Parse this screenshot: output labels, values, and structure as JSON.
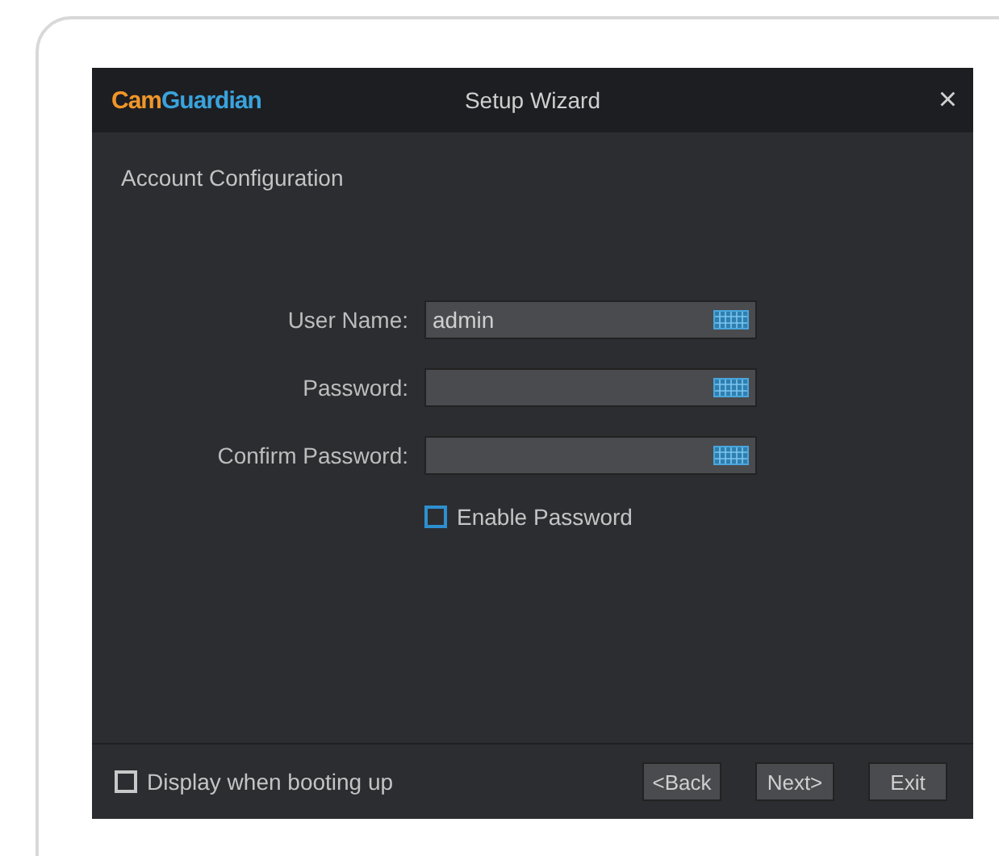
{
  "window": {
    "logo": [
      "Cam",
      "Guardian"
    ],
    "title": "Setup Wizard",
    "close": "×"
  },
  "section_title": "Account Configuration",
  "fields": [
    {
      "label": "User Name:",
      "value": "admin"
    },
    {
      "label": "Password:"
    },
    {
      "label": "Confirm Password:"
    }
  ],
  "enable_password": {
    "label": "Enable Password",
    "checked": false
  },
  "footer": {
    "display_on_boot": {
      "label": "Display when booting up",
      "checked": false
    },
    "buttons": [
      "<Back",
      "Next>",
      "Exit"
    ]
  }
}
